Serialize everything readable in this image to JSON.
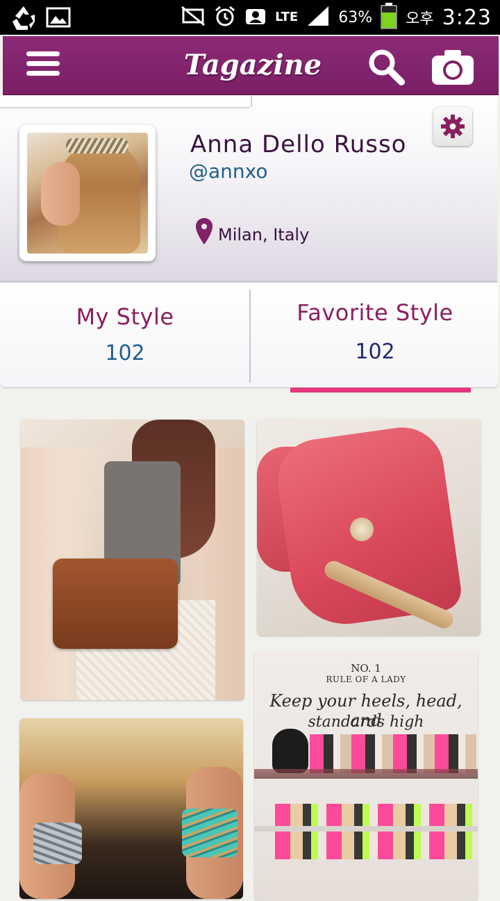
{
  "status_bar": {
    "battery_percent": "63%",
    "ampm": "오후",
    "time": "3:23",
    "network": "LTE",
    "battery_color": "#7ed321"
  },
  "app_bar": {
    "title": "Tagazine",
    "background": "#7f2268",
    "menu_icon": "hamburger-menu-icon",
    "search_icon": "search-icon",
    "camera_icon": "camera-icon"
  },
  "profile": {
    "name": "Anna Dello Russo",
    "handle": "@annxo",
    "location": "Milan, Italy",
    "location_icon": "map-pin-icon",
    "settings_icon": "gear-icon",
    "accent": "#8a1f5e"
  },
  "tabs": [
    {
      "label": "My Style",
      "count": "102",
      "active": false
    },
    {
      "label": "Favorite Style",
      "count": "102",
      "active": true
    }
  ],
  "tab_indicator_color": "#e5357d",
  "photos": {
    "items": [
      {
        "subject": "fashion-outfit-photo"
      },
      {
        "subject": "pink-boot-photo"
      },
      {
        "subject": "bracelets-photo"
      },
      {
        "subject": "shoe-shelf-photo"
      }
    ],
    "shoe_poster": {
      "number": "NO. 1",
      "rule": "RULE OF A LADY",
      "quote_line1": "Keep your heels, head, and",
      "quote_line2": "standards high"
    }
  }
}
